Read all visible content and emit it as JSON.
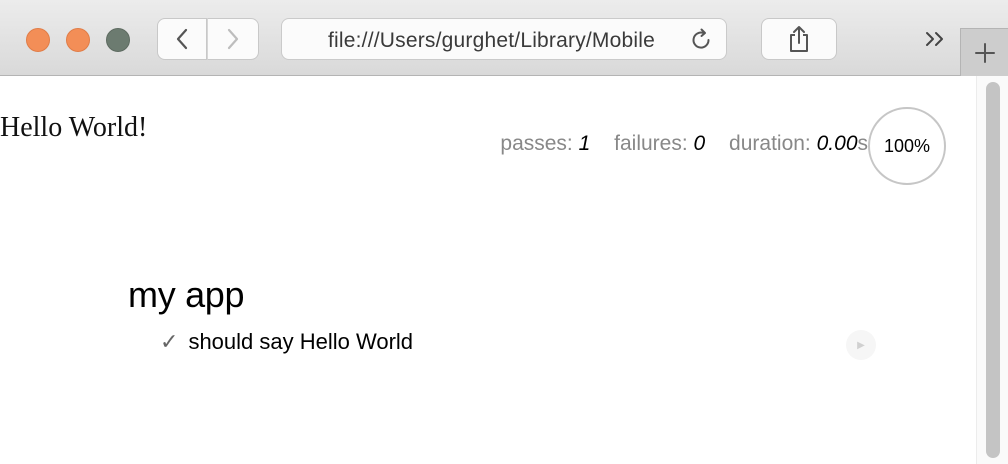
{
  "browser": {
    "url": "file:///Users/gurghet/Library/Mobile",
    "icons": {
      "back": "chevron-left-icon",
      "forward": "chevron-right-icon",
      "reload": "reload-icon",
      "share": "share-icon",
      "overflow": "double-chevron-right-icon",
      "new_tab": "plus-icon"
    }
  },
  "page": {
    "heading": "Hello World!",
    "stats": {
      "passes_label": "passes:",
      "passes_value": "1",
      "failures_label": "failures:",
      "failures_value": "0",
      "duration_label": "duration:",
      "duration_value": "0.00",
      "duration_unit": "s",
      "progress": "100%"
    },
    "suite": {
      "title": "my app",
      "tests": [
        {
          "check": "✓",
          "title": "should say Hello World",
          "replay": "▶"
        }
      ]
    }
  }
}
